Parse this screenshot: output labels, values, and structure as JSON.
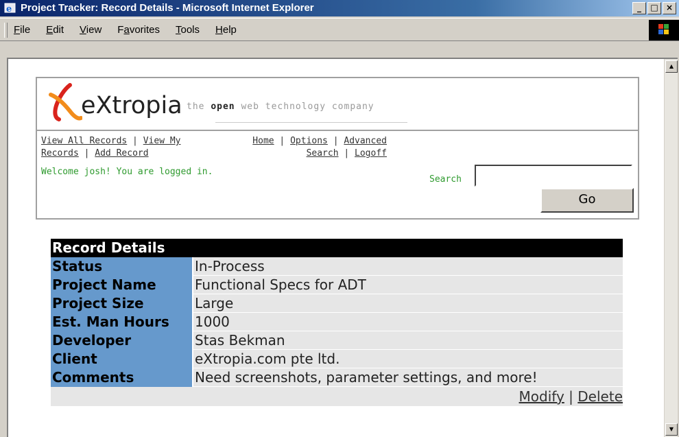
{
  "window": {
    "title": "Project Tracker: Record Details - Microsoft Internet Explorer",
    "minimize": "_",
    "maximize": "□",
    "close": "×"
  },
  "menu": {
    "items": [
      {
        "accel": "F",
        "rest": "ile"
      },
      {
        "accel": "E",
        "rest": "dit"
      },
      {
        "accel": "V",
        "rest": "iew"
      },
      {
        "pre": "F",
        "accel": "a",
        "rest": "vorites"
      },
      {
        "accel": "T",
        "rest": "ools"
      },
      {
        "accel": "H",
        "rest": "elp"
      }
    ]
  },
  "header": {
    "logo_text": "eXtropia",
    "tagline_pre": "the ",
    "tagline_bold": "open",
    "tagline_post": " web technology company"
  },
  "nav": {
    "view_all": "View All Records",
    "view_my": "View My Records",
    "add_record": "Add Record",
    "home": "Home",
    "options": "Options",
    "advanced_search": "Advanced Search",
    "logoff": "Logoff",
    "sep": " | "
  },
  "welcome": "Welcome josh! You are logged in.",
  "search": {
    "label": "Search",
    "value": "",
    "go_label": "Go"
  },
  "record": {
    "title": "Record Details",
    "rows": [
      {
        "label": "Status",
        "value": "In-Process"
      },
      {
        "label": "Project Name",
        "value": "Functional Specs for ADT"
      },
      {
        "label": "Project Size",
        "value": "Large"
      },
      {
        "label": "Est. Man Hours",
        "value": "1000"
      },
      {
        "label": "Developer",
        "value": "Stas Bekman"
      },
      {
        "label": "Client",
        "value": "eXtropia.com pte ltd."
      },
      {
        "label": "Comments",
        "value": "Need screenshots, parameter settings, and more!"
      }
    ],
    "modify_label": "Modify",
    "delete_label": "Delete",
    "action_sep": " | "
  },
  "colors": {
    "label_bg": "#6699cc",
    "welcome_green": "#2e9a2e",
    "logo_red": "#d9231c",
    "logo_orange": "#f28c1b"
  },
  "icons": {
    "app": "internet-explorer-icon",
    "windows_logo": "windows-flag-icon",
    "scroll_up": "scroll-up-arrow-icon",
    "scroll_down": "scroll-down-arrow-icon",
    "logo_mark": "extropia-x-logo"
  }
}
